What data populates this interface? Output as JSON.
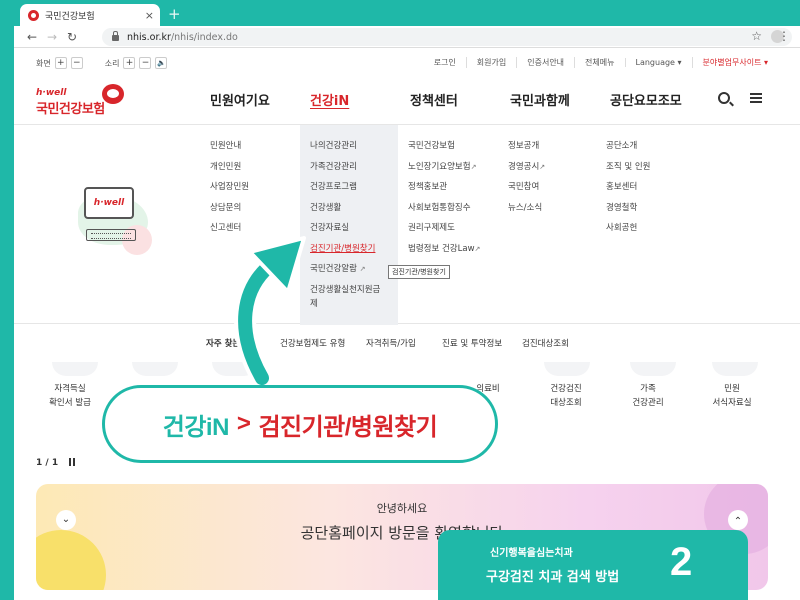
{
  "browser": {
    "tab_title": "국민건강보험",
    "tab_close": "×",
    "new_tab": "+",
    "back": "←",
    "forward": "→",
    "reload": "↻",
    "url_host": "nhis.or.kr",
    "url_path": "/nhis/index.do",
    "star": "☆",
    "menu": "⋮"
  },
  "util": {
    "screen_label": "화면",
    "sound_label": "소리",
    "plus": "+",
    "minus": "−",
    "speaker": "🔈",
    "links": [
      "로그인",
      "회원가입",
      "인증서안내",
      "전체메뉴",
      "Language ▾"
    ],
    "family_site": "분야별업무사이트 ▾"
  },
  "logo": {
    "hwell": "h·well",
    "name": "국민건강보험"
  },
  "gnb": [
    "민원여기요",
    "건강iN",
    "정책센터",
    "국민과함께",
    "공단요모조모"
  ],
  "illustration": {
    "monitor_text": "h·well"
  },
  "mega": {
    "col1": [
      "민원안내",
      "개인민원",
      "사업장민원",
      "상담문의",
      "신고센터"
    ],
    "col2": [
      "나의건강관리",
      "가족건강관리",
      "건강프로그램",
      "건강생활",
      "건강자료실",
      "검진기관/병원찾기",
      "국민건강알람",
      "건강생활실천지원금",
      "제"
    ],
    "col3": [
      "국민건강보험",
      "노인장기요양보험",
      "정책홍보관",
      "사회보험통합징수",
      "권리구제제도",
      "법령정보 건강Law"
    ],
    "col4": [
      "정보공개",
      "경영공시",
      "국민참여",
      "뉴스/소식"
    ],
    "col5": [
      "공단소개",
      "조직 및 인원",
      "홍보센터",
      "경영철학",
      "사회공헌"
    ],
    "ext_icon": "↗",
    "tooltip": "검진기관/병원찾기"
  },
  "freq": {
    "title": "자주 찾는 메뉴",
    "items": [
      "건강보험제도 유형",
      "자격취득/가입",
      "진료 및 투약정보",
      "검진대상조회"
    ]
  },
  "quick": [
    {
      "l1": "자격득실",
      "l2": "확인서 발급"
    },
    {
      "l1": "의료비",
      "l2": ""
    },
    {
      "l1": "건강검진",
      "l2": "대상조회"
    },
    {
      "l1": "가족",
      "l2": "건강관리"
    },
    {
      "l1": "민원",
      "l2": "서식자료실"
    }
  ],
  "pager": {
    "text": "1 / 1"
  },
  "banner": {
    "hello": "안녕하세요",
    "visit": "공단홈페이지 방문을 환영합니다",
    "down": "⌄",
    "up": "⌃"
  },
  "callout": {
    "part1": "건강iN",
    "sep": ">",
    "part2": "검진기관/병원찾기"
  },
  "caption": {
    "sub": "신기행복을심는치과",
    "main": "구강검진 치과 검색 방법",
    "num": "2"
  },
  "colors": {
    "teal": "#1fb8a8",
    "brand_red": "#d8262b"
  }
}
